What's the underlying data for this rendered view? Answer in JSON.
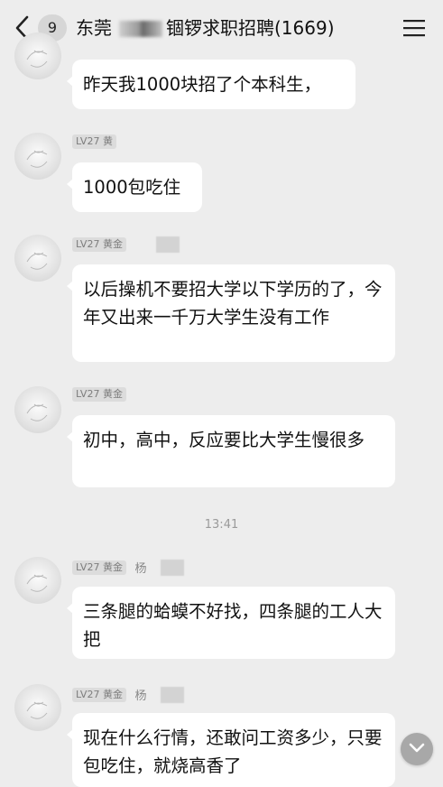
{
  "header": {
    "unread_count": "9",
    "title_left": "东莞",
    "title_right": "锢锣求职招聘(1669)"
  },
  "messages": [
    {
      "text": "昨天我1000块招了个本科生，"
    },
    {
      "level": "LV27 黄",
      "text": "1000包吃住"
    },
    {
      "level": "LV27 黄金",
      "text": "以后操机不要招大学以下学历的了，今年又出来一千万大学生没有工作"
    },
    {
      "level": "LV27 黄金",
      "text": "初中，高中，反应要比大学生慢很多"
    },
    {
      "level": "LV27 黄金",
      "sender": "杨",
      "text": "三条腿的蛤蟆不好找，四条腿的工人大把"
    },
    {
      "level": "LV27 黄金",
      "sender": "杨",
      "text": "现在什么行情，还敢问工资多少，只要包吃住，就烧高香了"
    }
  ],
  "time_divider": "13:41",
  "colors": {
    "background": "#ededed",
    "bubble": "#ffffff"
  },
  "icons": {
    "back": "chevron-left-icon",
    "menu": "hamburger-menu-icon",
    "scroll": "chevron-down-icon"
  }
}
